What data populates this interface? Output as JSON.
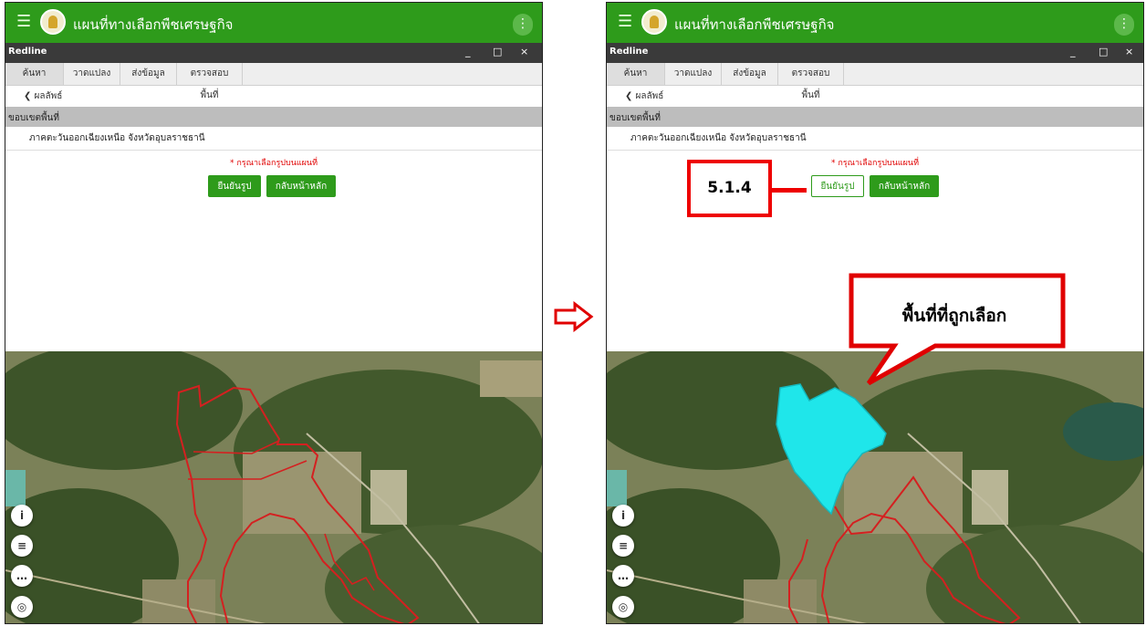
{
  "app": {
    "title": "แผนที่ทางเลือกพืชเศรษฐกิจ",
    "menu_icon": "hamburger-icon",
    "more_icon": "kebab-menu-icon"
  },
  "window": {
    "title": "Redline",
    "minimize": "_",
    "maximize": "□",
    "close": "×"
  },
  "tabs": [
    {
      "label": "ค้นหา",
      "active": true
    },
    {
      "label": "วาดแปลง",
      "active": false
    },
    {
      "label": "ส่งข้อมูล",
      "active": false
    },
    {
      "label": "ตรวจสอบพื้นที่",
      "active": false
    }
  ],
  "results": {
    "back_label": "❮ ผลลัพธ์",
    "section_label": "ขอบเขตพื้นที่",
    "region": "ภาคตะวันออกเฉียงเหนือ จังหวัดอุบลราชธานี",
    "warning": "* กรุณาเลือกรูปบนแผนที่",
    "confirm_label": "ยืนยันรูป",
    "home_label": "กลับหน้าหลัก"
  },
  "map_buttons": {
    "info": "i",
    "layers": "≡",
    "more": "…",
    "locate": "◎"
  },
  "annotations": {
    "step_label": "5.1.4",
    "selected_area_label": "พื้นที่ที่ถูกเลือก",
    "arrow_color": "#e00000"
  },
  "colors": {
    "brand_green": "#2e9b1b",
    "window_bar": "#3a3a3a",
    "boundary_red": "#d42020",
    "selection_cyan": "#1fe6ea"
  }
}
